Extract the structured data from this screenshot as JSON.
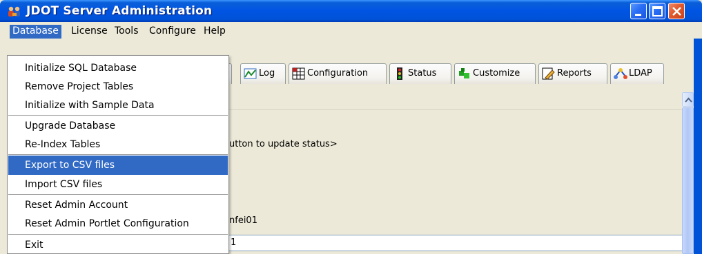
{
  "window": {
    "title": "JDOT Server Administration"
  },
  "menubar": {
    "items": [
      {
        "label": "Database",
        "active": true
      },
      {
        "label": "License"
      },
      {
        "label": "Tools"
      },
      {
        "label": "Configure"
      },
      {
        "label": "Help"
      }
    ]
  },
  "database_menu": {
    "items": [
      {
        "label": "Initialize SQL Database"
      },
      {
        "label": "Remove Project Tables"
      },
      {
        "label": "Initialize with Sample Data"
      },
      {
        "label": "Upgrade Database"
      },
      {
        "label": "Re-Index Tables"
      },
      {
        "label": "Export to CSV files",
        "highlighted": true
      },
      {
        "label": "Import CSV files"
      },
      {
        "label": "Reset Admin Account"
      },
      {
        "label": "Reset Admin Portlet Configuration"
      },
      {
        "label": "Exit"
      }
    ]
  },
  "tabs": [
    {
      "label": "Log",
      "icon": "log-chart-icon"
    },
    {
      "label": "Configuration",
      "icon": "configuration-grid-icon"
    },
    {
      "label": "Status",
      "icon": "traffic-light-icon"
    },
    {
      "label": "Customize",
      "icon": "customize-puzzle-icon"
    },
    {
      "label": "Reports",
      "icon": "reports-pencil-icon"
    },
    {
      "label": "LDAP",
      "icon": "ldap-network-icon"
    }
  ],
  "content": {
    "status_fragment": "utton to update status>",
    "user_fragment": "nfei01",
    "value_fragment": "1"
  },
  "colors": {
    "titlebar": "#0054e3",
    "menu_highlight": "#316ac5",
    "close_button": "#e2592d"
  }
}
